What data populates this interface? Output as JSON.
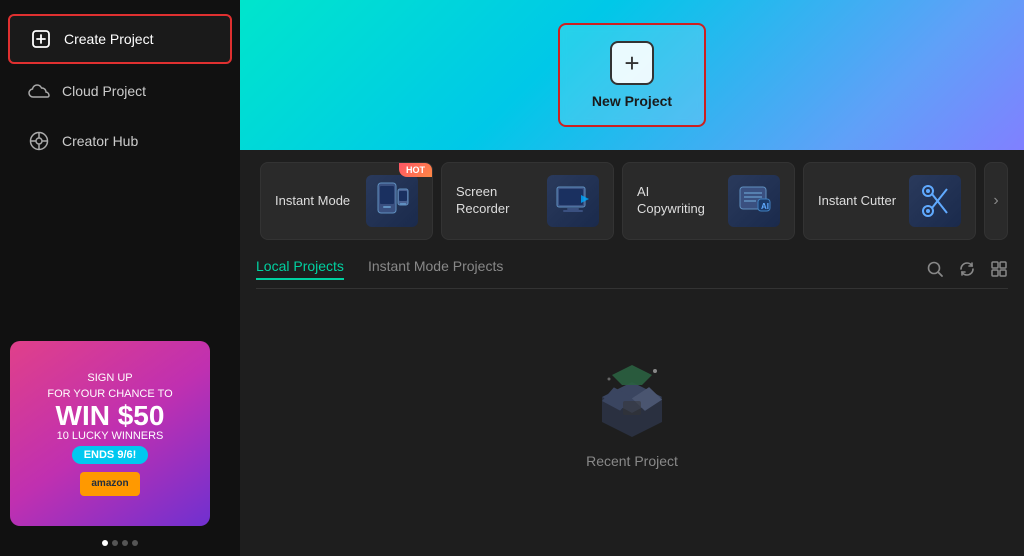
{
  "sidebar": {
    "items": [
      {
        "id": "create-project",
        "label": "Create Project",
        "icon": "➕",
        "active": true
      },
      {
        "id": "cloud-project",
        "label": "Cloud Project",
        "icon": "☁",
        "active": false
      },
      {
        "id": "creator-hub",
        "label": "Creator Hub",
        "icon": "💡",
        "active": false
      }
    ]
  },
  "hero": {
    "new_project_label": "New Project"
  },
  "tools": [
    {
      "id": "instant-mode",
      "label": "Instant Mode",
      "emoji": "📱",
      "hot": true
    },
    {
      "id": "screen-recorder",
      "label": "Screen Recorder",
      "emoji": "🖥",
      "hot": false
    },
    {
      "id": "ai-copywriting",
      "label": "AI Copywriting",
      "emoji": "🤖",
      "hot": false
    },
    {
      "id": "instant-cutter",
      "label": "Instant Cutter",
      "emoji": "✂",
      "hot": false
    }
  ],
  "tabs": [
    {
      "id": "local-projects",
      "label": "Local Projects",
      "active": true
    },
    {
      "id": "instant-mode-projects",
      "label": "Instant Mode Projects",
      "active": false
    }
  ],
  "tab_icons": {
    "search": "🔍",
    "refresh": "🔄",
    "grid": "⊞"
  },
  "empty_state": {
    "label": "Recent Project"
  },
  "ad": {
    "line1": "SIGN UP",
    "line2": "FOR YOUR CHANCE TO",
    "win": "WIN $50",
    "lucky": "10 LUCKY WINNERS",
    "ends": "ENDS 9/6!"
  }
}
